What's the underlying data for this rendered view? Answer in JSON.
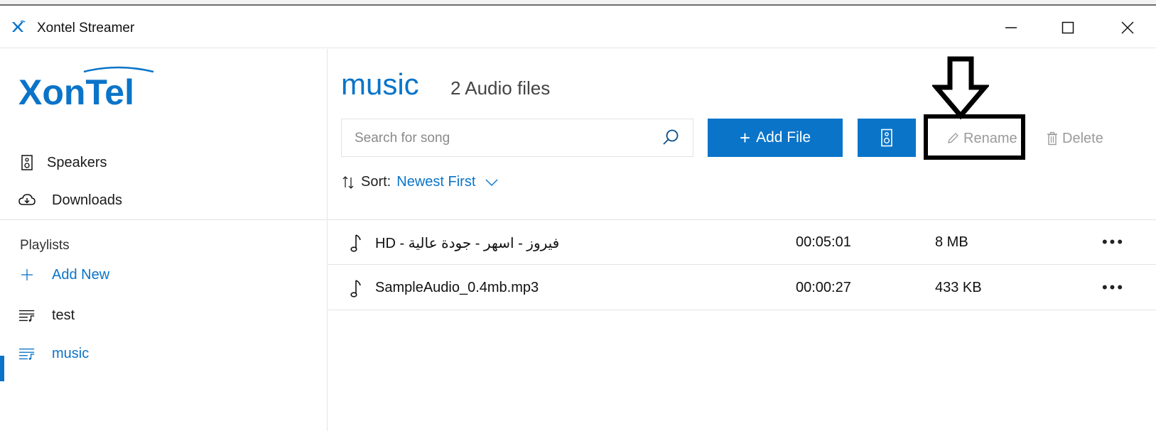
{
  "window": {
    "title": "Xontel Streamer",
    "minimize": "minimize",
    "maximize": "maximize",
    "close": "close"
  },
  "sidebar": {
    "logo_text": "XonTel",
    "nav": [
      {
        "label": "Speakers",
        "icon": "speaker-icon"
      },
      {
        "label": "Downloads",
        "icon": "cloud-download-icon"
      }
    ],
    "playlists_heading": "Playlists",
    "add_new_label": "Add New",
    "playlists": [
      {
        "label": "test",
        "icon": "playlist-icon",
        "active": false
      },
      {
        "label": "music",
        "icon": "playlist-icon",
        "active": true
      }
    ]
  },
  "main": {
    "title": "music",
    "subtitle": "2 Audio files",
    "search_placeholder": "Search for song",
    "add_file_label": "Add File",
    "rename_label": "Rename",
    "delete_label": "Delete",
    "sort_label": "Sort:",
    "sort_value": "Newest First"
  },
  "files": [
    {
      "name": "فيروز - اسهر - جودة عالية - HD",
      "duration": "00:05:01",
      "size": "8 MB"
    },
    {
      "name": "SampleAudio_0.4mb.mp3",
      "duration": "00:00:27",
      "size": "433 KB"
    }
  ],
  "colors": {
    "accent": "#0a74c9",
    "disabled_text": "#9a9a9a",
    "annotation": "#000000"
  }
}
